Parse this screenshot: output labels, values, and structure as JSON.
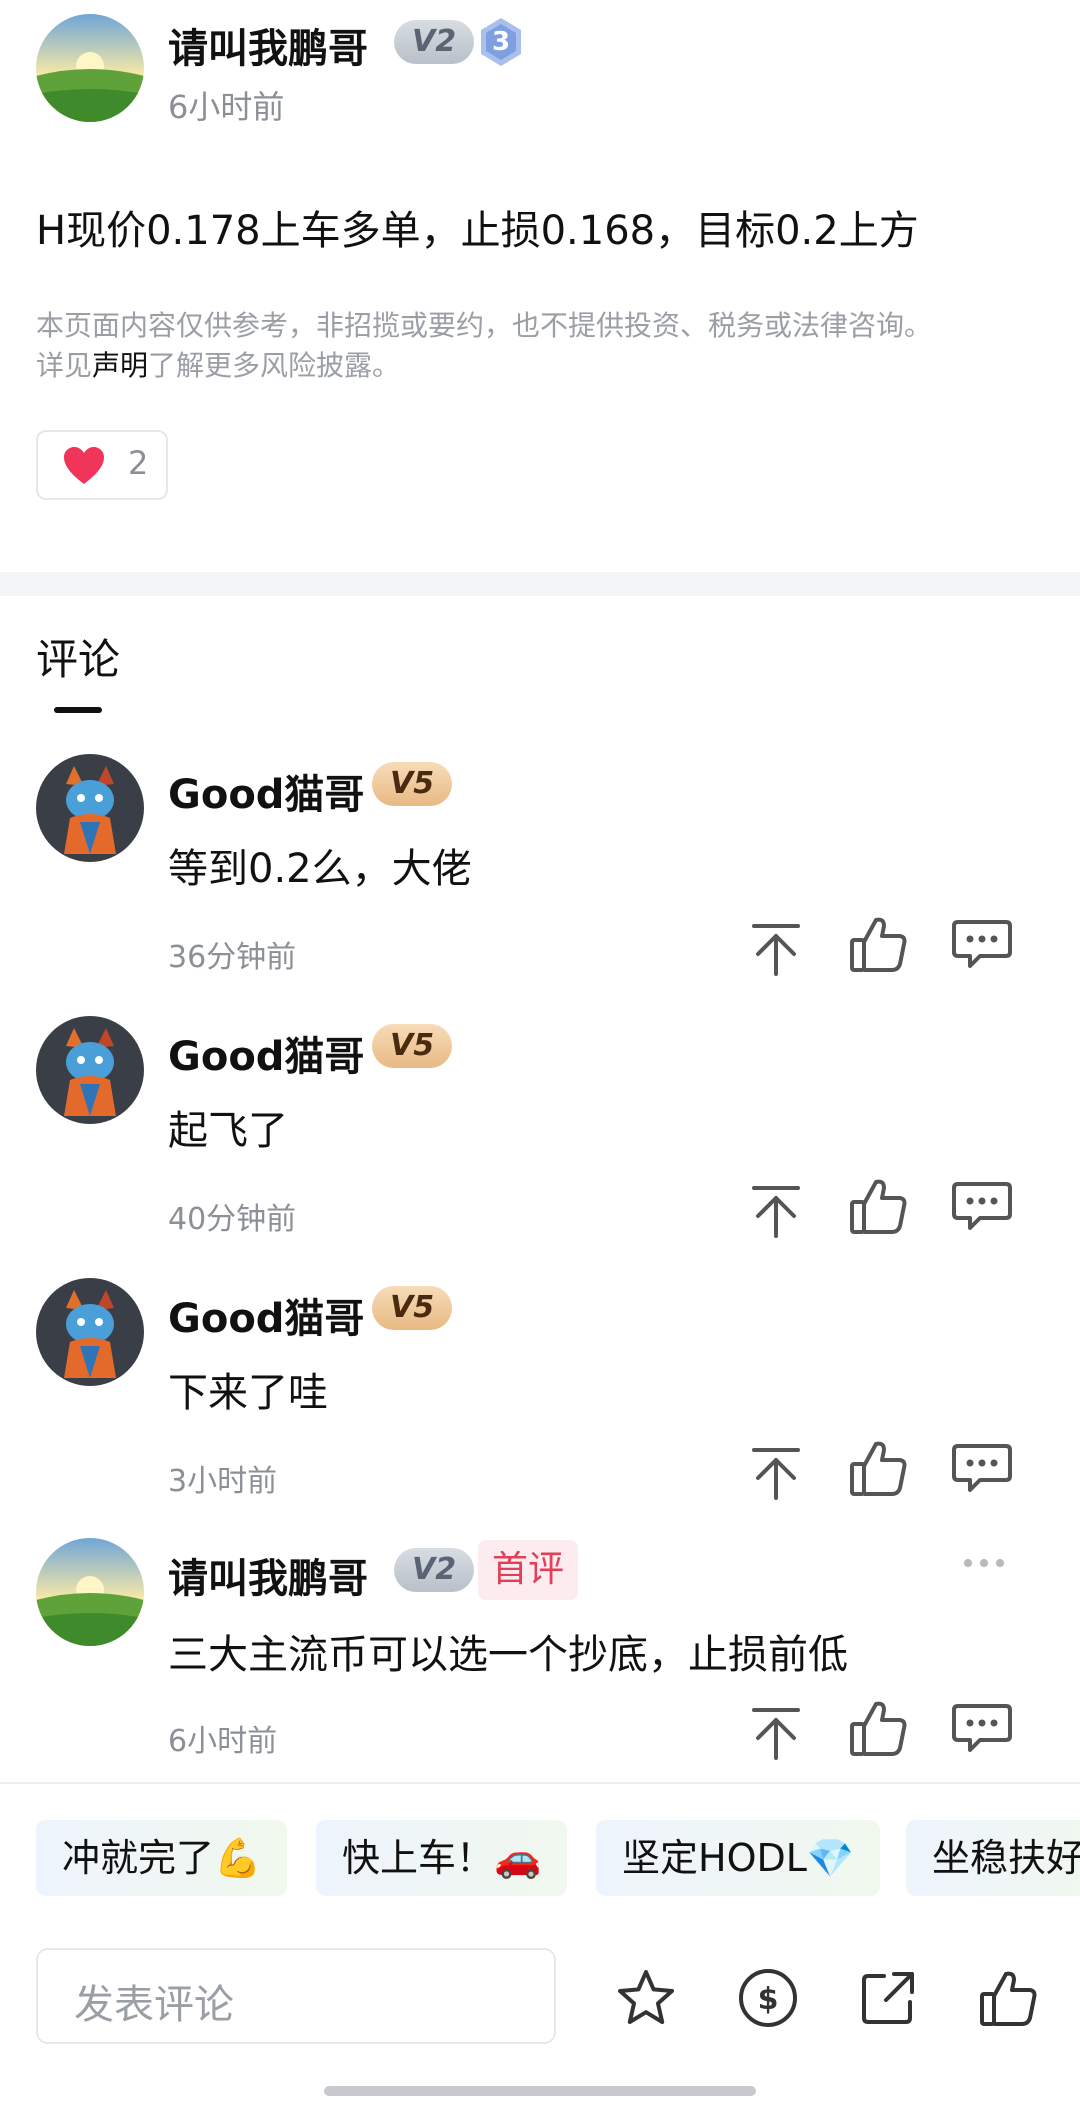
{
  "post": {
    "author": "请叫我鹏哥",
    "level_badge": "V2",
    "rank_badge": "3",
    "time": "6小时前",
    "content": "H现价0.178上车多单，止损0.168，目标0.2上方",
    "disclaimer_line1": "本页面内容仅供参考，非招揽或要约，也不提供投资、税务或法律咨询。",
    "disclaimer_prefix": "详见",
    "disclaimer_link": "声明",
    "disclaimer_suffix": "了解更多风险披露。",
    "like_count": "2"
  },
  "comments_section": {
    "title": "评论"
  },
  "comments": [
    {
      "author": "Good猫哥",
      "badge": "V5",
      "text": "等到0.2么，大佬",
      "time": "36分钟前"
    },
    {
      "author": "Good猫哥",
      "badge": "V5",
      "text": "起飞了",
      "time": "40分钟前"
    },
    {
      "author": "Good猫哥",
      "badge": "V5",
      "text": "下来了哇",
      "time": "3小时前"
    },
    {
      "author": "请叫我鹏哥",
      "badge": "V2",
      "tag": "首评",
      "text": "三大主流币可以选一个抄底，止损前低",
      "time": "6小时前"
    }
  ],
  "quick_replies": [
    "冲就完了💪",
    "快上车！🚗",
    "坚定HODL💎",
    "坐稳扶好"
  ],
  "bottom_bar": {
    "input_placeholder": "发表评论"
  },
  "icons": {
    "pin": "arrow-up-to-line-icon",
    "like": "thumbs-up-icon",
    "reply": "chat-bubble-icon",
    "more": "ellipsis-icon",
    "star": "star-icon",
    "tip": "coin-icon",
    "share": "share-icon"
  },
  "colors": {
    "heart": "#f0345a",
    "first_tag_bg": "#fdecef",
    "first_tag_text": "#e0405a",
    "chip_bg": "#eef4fb"
  }
}
